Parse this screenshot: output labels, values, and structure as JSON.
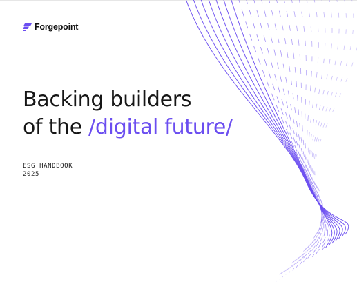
{
  "brand": {
    "name": "Forgepoint",
    "logo_icon": "forgepoint-slash-mark-icon",
    "logo_color": "#6b4ef0"
  },
  "cover": {
    "title_line1": "Backing builders",
    "title_line2_prefix": "of the ",
    "title_line2_accent": "/digital future/",
    "doc_label": "ESG HANDBOOK",
    "year": "2025"
  },
  "colors": {
    "accent": "#6b4ef0",
    "text": "#161616",
    "background": "#ffffff"
  }
}
